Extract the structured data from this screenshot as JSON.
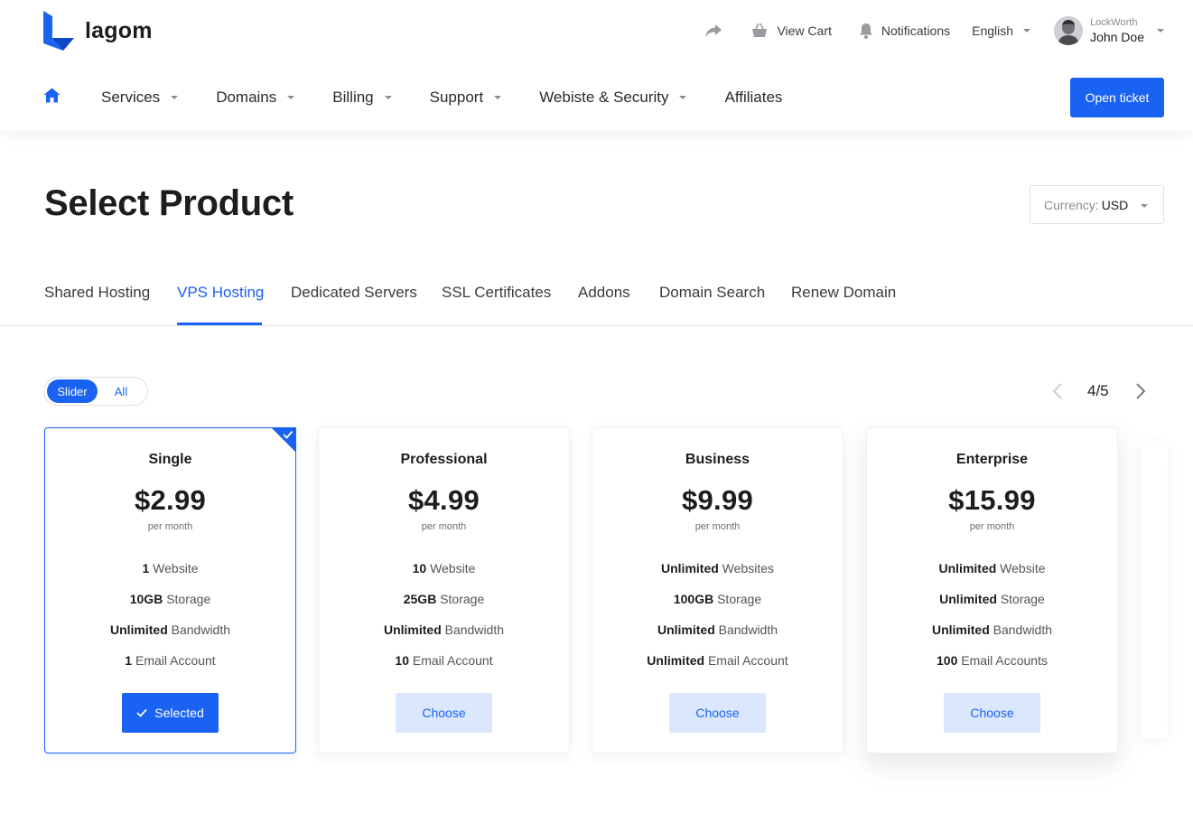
{
  "brand": {
    "name": "lagom",
    "accent": "#1a62f2"
  },
  "utilities": {
    "share_icon": "share-arrow-icon",
    "cart_label": "View Cart",
    "notifications_label": "Notifications",
    "language": "English",
    "user_company": "LockWorth",
    "user_name": "John Doe"
  },
  "nav": {
    "items": [
      {
        "label": "Services",
        "has_dropdown": true
      },
      {
        "label": "Domains",
        "has_dropdown": true
      },
      {
        "label": "Billing",
        "has_dropdown": true
      },
      {
        "label": "Support",
        "has_dropdown": true
      },
      {
        "label": "Webiste & Security",
        "has_dropdown": true
      },
      {
        "label": "Affiliates",
        "has_dropdown": false
      }
    ],
    "cta": "Open ticket"
  },
  "page": {
    "title": "Select Product",
    "currency_label": "Currency:",
    "currency_value": "USD"
  },
  "tabs": {
    "items": [
      {
        "label": "Shared Hosting"
      },
      {
        "label": "VPS Hosting",
        "active": true
      },
      {
        "label": "Dedicated Servers"
      },
      {
        "label": "SSL Certificates"
      },
      {
        "label": "Addons"
      },
      {
        "label": "Domain Search"
      },
      {
        "label": "Renew Domain"
      }
    ]
  },
  "view_toggle": {
    "slider_label": "Slider",
    "all_label": "All",
    "selected": "Slider"
  },
  "pager": {
    "text": "4/5"
  },
  "products": [
    {
      "name": "Single",
      "price": "$2.99",
      "period": "per month",
      "features": [
        {
          "bold": "1",
          "text": "Website"
        },
        {
          "bold": "10GB",
          "text": "Storage"
        },
        {
          "bold": "Unlimited",
          "text": "Bandwidth"
        },
        {
          "bold": "1",
          "text": "Email Account"
        }
      ],
      "button": "Selected",
      "selected": true
    },
    {
      "name": "Professional",
      "price": "$4.99",
      "period": "per month",
      "features": [
        {
          "bold": "10",
          "text": "Website"
        },
        {
          "bold": "25GB",
          "text": "Storage"
        },
        {
          "bold": "Unlimited",
          "text": "Bandwidth"
        },
        {
          "bold": "10",
          "text": "Email Account"
        }
      ],
      "button": "Choose",
      "selected": false
    },
    {
      "name": "Business",
      "price": "$9.99",
      "period": "per month",
      "features": [
        {
          "bold": "Unlimited",
          "text": "Websites"
        },
        {
          "bold": "100GB",
          "text": "Storage"
        },
        {
          "bold": "Unlimited",
          "text": "Bandwidth"
        },
        {
          "bold": "Unlimited",
          "text": "Email Account"
        }
      ],
      "button": "Choose",
      "selected": false
    },
    {
      "name": "Enterprise",
      "price": "$15.99",
      "period": "per month",
      "features": [
        {
          "bold": "Unlimited",
          "text": "Website"
        },
        {
          "bold": "Unlimited",
          "text": "Storage"
        },
        {
          "bold": "Unlimited",
          "text": "Bandwidth"
        },
        {
          "bold": "100",
          "text": "Email Accounts"
        }
      ],
      "button": "Choose",
      "selected": false
    }
  ]
}
